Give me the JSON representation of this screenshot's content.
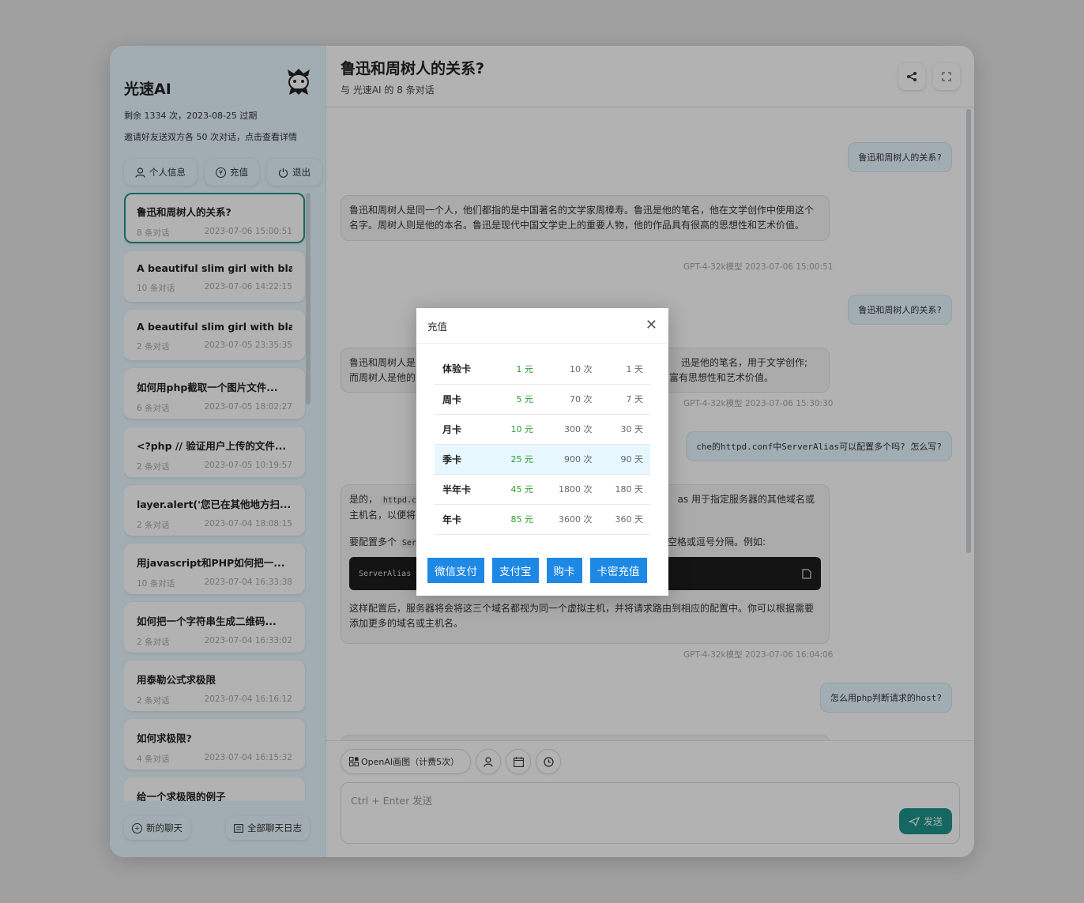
{
  "sidebar": {
    "brand": "光速AI",
    "remaining": "剩余 1334 次，2023-08-25 过期",
    "invite": "邀请好友送双方各 50 次对话，点击查看详情",
    "actions": {
      "profile": "个人信息",
      "recharge": "充值",
      "logout": "退出"
    },
    "chats": [
      {
        "title": "鲁迅和周树人的关系?",
        "count": "8 条对话",
        "time": "2023-07-06 15:00:51"
      },
      {
        "title": "A beautiful slim girl with bla...",
        "count": "10 条对话",
        "time": "2023-07-06 14:22:15"
      },
      {
        "title": "A beautiful slim girl with bla...",
        "count": "2 条对话",
        "time": "2023-07-05 23:35:35"
      },
      {
        "title": "如何用php截取一个图片文件...",
        "count": "6 条对话",
        "time": "2023-07-05 18:02:27"
      },
      {
        "title": "<?php // 验证用户上传的文件...",
        "count": "2 条对话",
        "time": "2023-07-05 10:19:57"
      },
      {
        "title": "layer.alert('您已在其他地方扫...",
        "count": "2 条对话",
        "time": "2023-07-04 18:08:15"
      },
      {
        "title": "用javascript和PHP如何把一...",
        "count": "10 条对话",
        "time": "2023-07-04 16:33:38"
      },
      {
        "title": "如何把一个字符串生成二维码...",
        "count": "2 条对话",
        "time": "2023-07-04 16:33:02"
      },
      {
        "title": "用泰勒公式求极限",
        "count": "2 条对话",
        "time": "2023-07-04 16:16:12"
      },
      {
        "title": "如何求极限?",
        "count": "4 条对话",
        "time": "2023-07-04 16:15:32"
      },
      {
        "title": "给一个求极限的例子",
        "count": "",
        "time": ""
      }
    ],
    "new_chat": "新的聊天",
    "all_logs": "全部聊天日志"
  },
  "header": {
    "title": "鲁迅和周树人的关系?",
    "subtitle": "与 光速AI 的 8 条对话"
  },
  "messages": {
    "u1": "鲁迅和周树人的关系?",
    "b1": "鲁迅和周树人是同一个人，他们都指的是中国著名的文学家周樟寿。鲁迅是他的笔名，他在文学创作中使用这个名字。周树人则是他的本名。鲁迅是现代中国文学史上的重要人物，他的作品具有很高的思想性和艺术价值。",
    "m1": "GPT-4-32k模型  2023-07-06 15:00:51",
    "u2": "鲁迅和周树人的关系?",
    "b2_line1": "鲁迅和周树人是",
    "b2_line1_right": "迅是他的笔名，用于文学创作;",
    "b2_line2": "而周树人是他的",
    "b2_line2_right": "富有思想性和艺术价值。",
    "m2": "GPT-4-32k模型  2023-07-06 15:30:30",
    "u3": "che的httpd.conf中ServerAlias可以配置多个吗? 怎么写?",
    "b3_p1a": "是的，",
    "b3_code1": "httpd.c",
    "b3_p1b": "as 用于指定服务器的其他域名或",
    "b3_p1c": "主机名，以便将",
    "b3_p2a": "要配置多个",
    "b3_p2b": "Ser",
    "b3_p2c": "空格或逗号分隔。例如:",
    "b3_codeblock": "ServerAlias",
    "b3_p3": "这样配置后，服务器将会将这三个域名都视为同一个虚拟主机，并将请求路由到相应的配置中。你可以根据需要添加更多的域名或主机名。",
    "m3": "GPT-4-32k模型  2023-07-06 16:04:06",
    "u4": "怎么用php判断请求的host?"
  },
  "composer": {
    "draw_tool": "OpenAI画图（计费5次）",
    "placeholder": "Ctrl + Enter 发送",
    "send": "发送"
  },
  "modal": {
    "title": "充值",
    "plans": [
      {
        "name": "体验卡",
        "price": "1 元",
        "times": "10 次",
        "days": "1 天"
      },
      {
        "name": "周卡",
        "price": "5 元",
        "times": "70 次",
        "days": "7 天"
      },
      {
        "name": "月卡",
        "price": "10 元",
        "times": "300 次",
        "days": "30 天"
      },
      {
        "name": "季卡",
        "price": "25 元",
        "times": "900 次",
        "days": "90 天"
      },
      {
        "name": "半年卡",
        "price": "45 元",
        "times": "1800 次",
        "days": "180 天"
      },
      {
        "name": "年卡",
        "price": "85 元",
        "times": "3600 次",
        "days": "360 天"
      }
    ],
    "buttons": {
      "wechat": "微信支付",
      "alipay": "支付宝",
      "buy_card": "购卡",
      "card_recharge": "卡密充值"
    }
  },
  "colors": {
    "accent": "#1f948c",
    "pay_button": "#1e88e5",
    "price": "#2e9b2e",
    "sidebar_bg": "#e7f8ff"
  }
}
